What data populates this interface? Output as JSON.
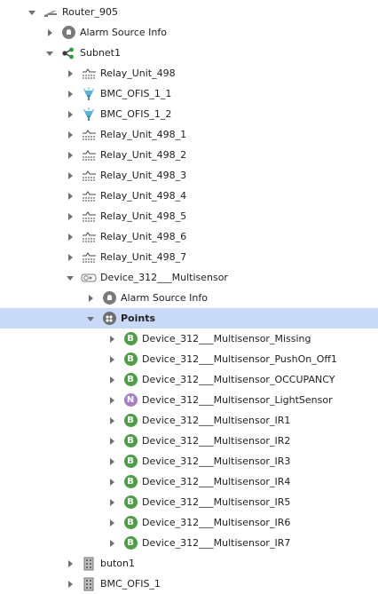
{
  "tree": {
    "rows": [
      {
        "label": "Router_905",
        "icon": "router-icon",
        "state": "expanded"
      },
      {
        "label": "Alarm Source Info",
        "icon": "alarm-bell-icon",
        "state": "collapsed"
      },
      {
        "label": "Subnet1",
        "icon": "network-share-icon",
        "state": "expanded"
      },
      {
        "label": "Relay_Unit_498",
        "icon": "relay-unit-icon",
        "state": "collapsed"
      },
      {
        "label": "BMC_OFIS_1_1",
        "icon": "sensor-device-icon",
        "state": "collapsed"
      },
      {
        "label": "BMC_OFIS_1_2",
        "icon": "sensor-device-icon",
        "state": "collapsed"
      },
      {
        "label": "Relay_Unit_498_1",
        "icon": "relay-unit-icon",
        "state": "collapsed"
      },
      {
        "label": "Relay_Unit_498_2",
        "icon": "relay-unit-icon",
        "state": "collapsed"
      },
      {
        "label": "Relay_Unit_498_3",
        "icon": "relay-unit-icon",
        "state": "collapsed"
      },
      {
        "label": "Relay_Unit_498_4",
        "icon": "relay-unit-icon",
        "state": "collapsed"
      },
      {
        "label": "Relay_Unit_498_5",
        "icon": "relay-unit-icon",
        "state": "collapsed"
      },
      {
        "label": "Relay_Unit_498_6",
        "icon": "relay-unit-icon",
        "state": "collapsed"
      },
      {
        "label": "Relay_Unit_498_7",
        "icon": "relay-unit-icon",
        "state": "collapsed"
      },
      {
        "label": "Device_312___Multisensor",
        "icon": "multisensor-icon",
        "state": "expanded"
      },
      {
        "label": "Alarm Source Info",
        "icon": "alarm-bell-icon",
        "state": "collapsed"
      },
      {
        "label": "Points",
        "icon": "points-icon",
        "state": "expanded",
        "selected": true
      },
      {
        "label": "Device_312___Multisensor_Missing",
        "icon": "boolean-point-icon",
        "badge": "B",
        "state": "collapsed"
      },
      {
        "label": "Device_312___Multisensor_PushOn_Off1",
        "icon": "boolean-point-icon",
        "badge": "B",
        "state": "collapsed"
      },
      {
        "label": "Device_312___Multisensor_OCCUPANCY",
        "icon": "boolean-point-icon",
        "badge": "B",
        "state": "collapsed"
      },
      {
        "label": "Device_312___Multisensor_LightSensor",
        "icon": "numeric-point-icon",
        "badge": "N",
        "state": "collapsed"
      },
      {
        "label": "Device_312___Multisensor_IR1",
        "icon": "boolean-point-icon",
        "badge": "B",
        "state": "collapsed"
      },
      {
        "label": "Device_312___Multisensor_IR2",
        "icon": "boolean-point-icon",
        "badge": "B",
        "state": "collapsed"
      },
      {
        "label": "Device_312___Multisensor_IR3",
        "icon": "boolean-point-icon",
        "badge": "B",
        "state": "collapsed"
      },
      {
        "label": "Device_312___Multisensor_IR4",
        "icon": "boolean-point-icon",
        "badge": "B",
        "state": "collapsed"
      },
      {
        "label": "Device_312___Multisensor_IR5",
        "icon": "boolean-point-icon",
        "badge": "B",
        "state": "collapsed"
      },
      {
        "label": "Device_312___Multisensor_IR6",
        "icon": "boolean-point-icon",
        "badge": "B",
        "state": "collapsed"
      },
      {
        "label": "Device_312___Multisensor_IR7",
        "icon": "boolean-point-icon",
        "badge": "B",
        "state": "collapsed"
      },
      {
        "label": "buton1",
        "icon": "panel-device-icon",
        "state": "collapsed"
      },
      {
        "label": "BMC_OFIS_1",
        "icon": "panel-device-icon",
        "state": "collapsed"
      }
    ]
  },
  "colors": {
    "selection": "#c9d9f8",
    "boolean_badge": "#4f9d49",
    "numeric_badge": "#a77fc3",
    "arrow": "#6f6f6f"
  }
}
